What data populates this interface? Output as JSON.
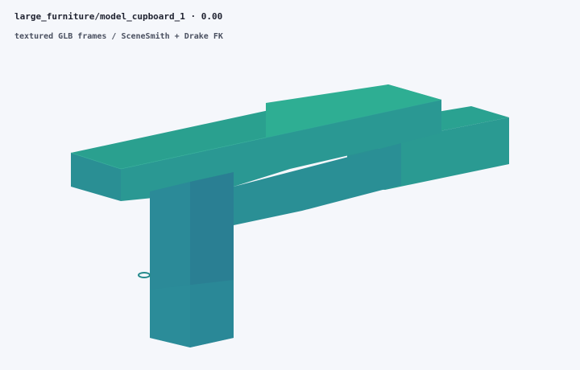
{
  "viewer": {
    "title": "large_furniture/model_cupboard_1 · 0.00",
    "subtitle": "textured GLB frames / SceneSmith + Drake FK"
  },
  "render": {
    "model": "cupboard",
    "colors": {
      "background": "#f5f7fb",
      "top_light": "#2eae93",
      "top_mid": "#2aa08f",
      "front": "#2a9393",
      "side_dark": "#2a8796",
      "leg_front": "#2b8a98",
      "leg_side": "#2a7f93",
      "edge": "#258a8c"
    }
  }
}
